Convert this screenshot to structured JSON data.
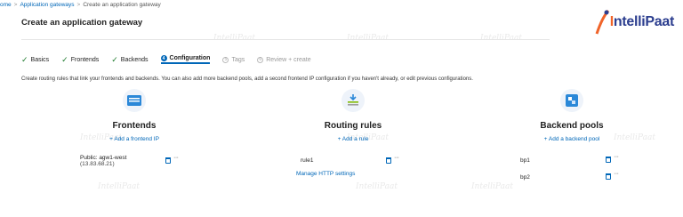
{
  "breadcrumb": {
    "items": [
      "ome",
      "Application gateways",
      "Create an application gateway"
    ]
  },
  "page": {
    "title": "Create an application gateway"
  },
  "logo": {
    "text_prefix": "I",
    "text_rest": "ntelliPaat"
  },
  "watermark": "IntelliPaat",
  "tabs": [
    {
      "label": "Basics",
      "state": "done"
    },
    {
      "label": "Frontends",
      "state": "done"
    },
    {
      "label": "Backends",
      "state": "done"
    },
    {
      "label": "Configuration",
      "state": "active",
      "number": "4"
    },
    {
      "label": "Tags",
      "state": "disabled",
      "number": "5"
    },
    {
      "label": "Review + create",
      "state": "disabled",
      "number": "6"
    }
  ],
  "description": "Create routing rules that link your frontends and backends. You can also add more backend pools, add a second frontend IP configuration if you haven't already, or edit previous configurations.",
  "frontends": {
    "title": "Frontends",
    "add_label": "+ Add a frontend IP",
    "item_name": "Public: agw1-west",
    "item_ip": "(13.83.68.21)"
  },
  "routing": {
    "title": "Routing rules",
    "add_label": "+ Add a rule",
    "item_name": "rule1",
    "manage_label": "Manage HTTP settings"
  },
  "backends": {
    "title": "Backend pools",
    "add_label": "+ Add a backend pool",
    "items": [
      "bp1",
      "bp2"
    ]
  },
  "colors": {
    "accent": "#0067b8",
    "check": "#1e7b2e",
    "logo_blue": "#2c3e8f",
    "logo_orange": "#f0642a"
  }
}
